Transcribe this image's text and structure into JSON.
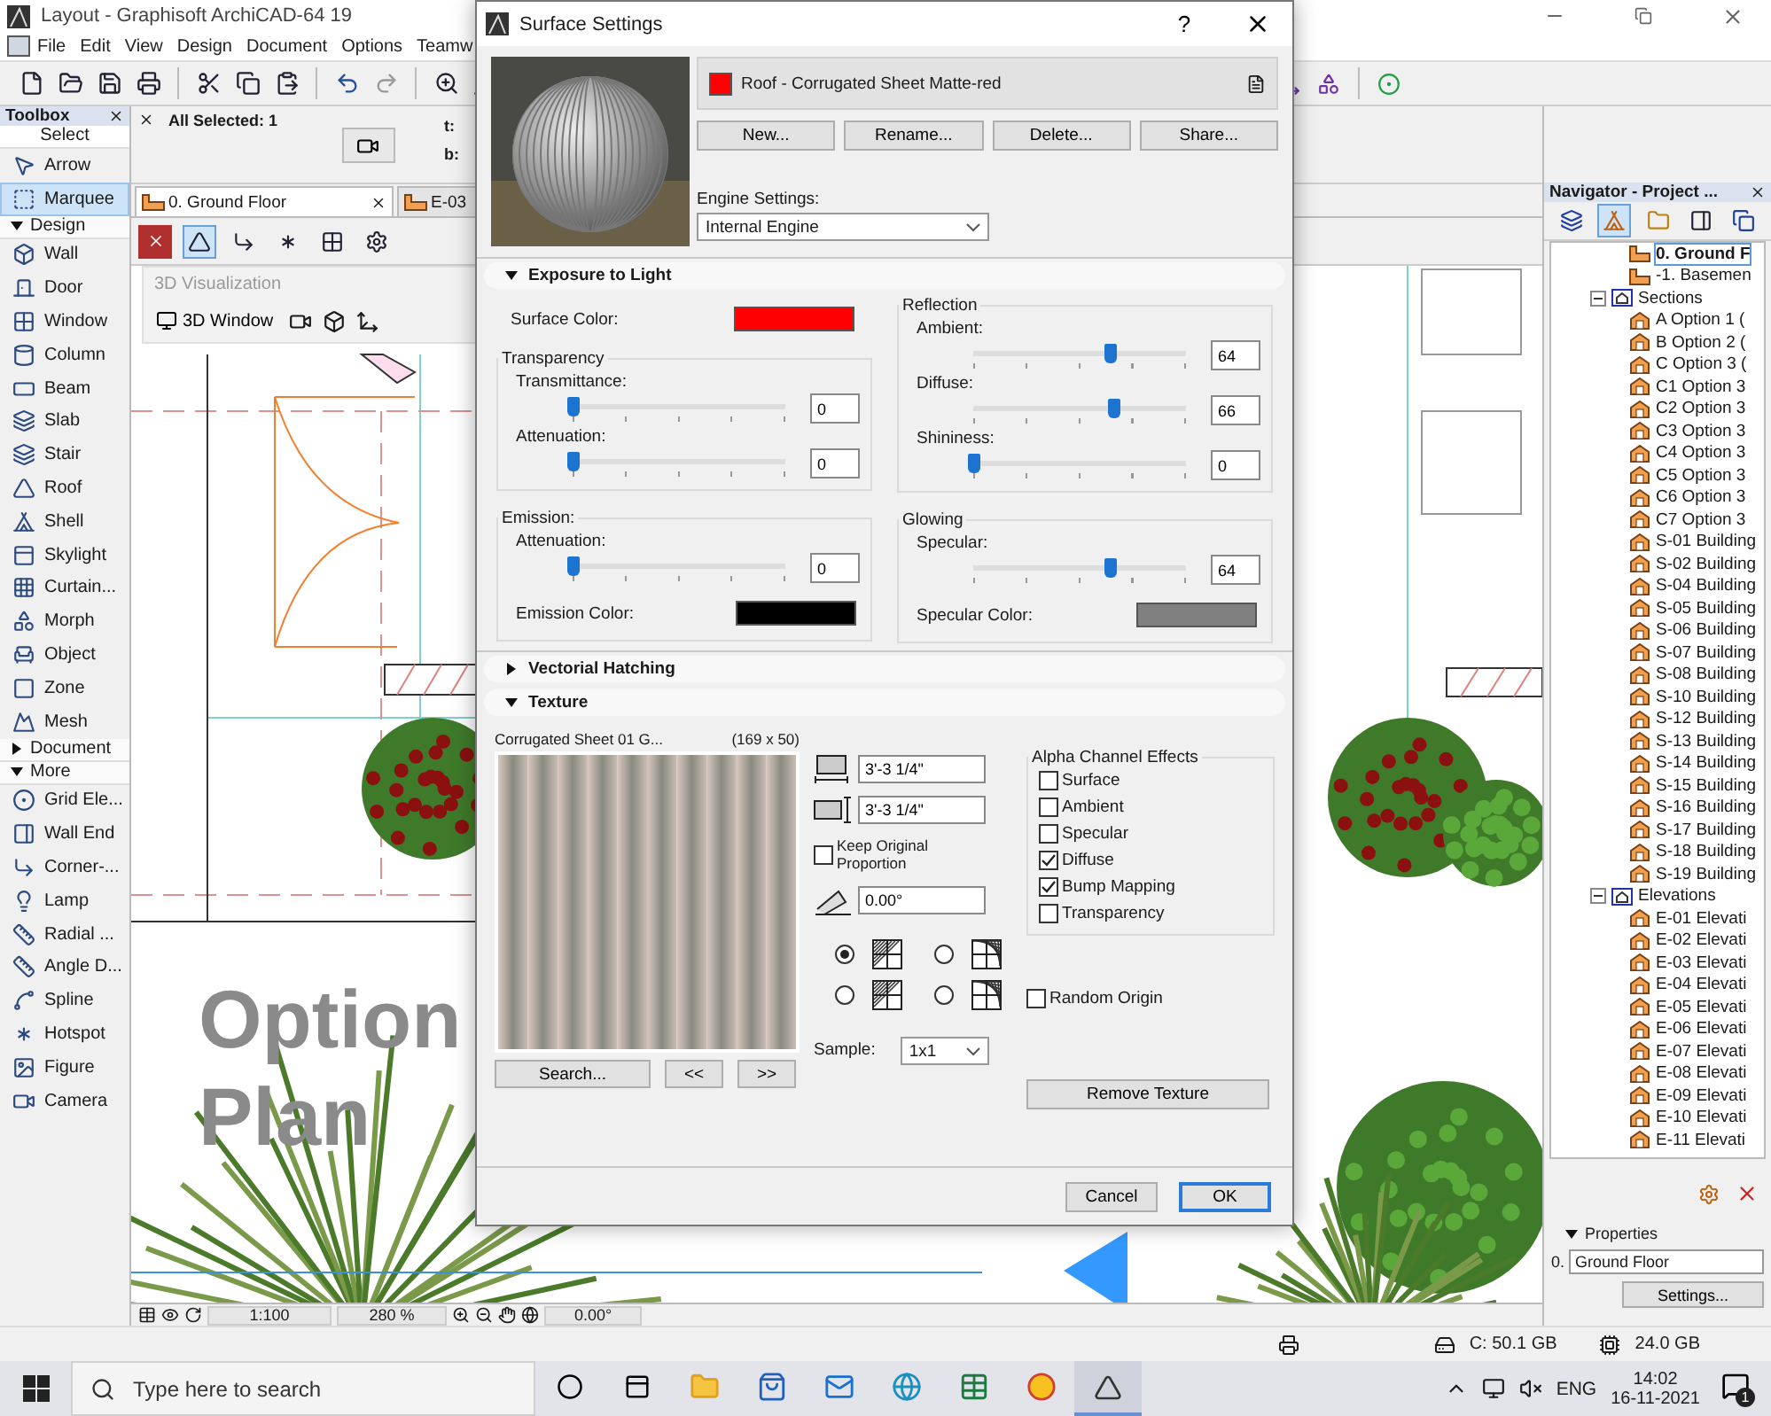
{
  "app": {
    "title": "Layout - Graphisoft ArchiCAD-64 19",
    "menu": [
      "File",
      "Edit",
      "View",
      "Design",
      "Document",
      "Options",
      "Teamw"
    ]
  },
  "toolbox": {
    "title": "Toolbox",
    "select": {
      "label": "Select",
      "tools": [
        {
          "label": "Arrow",
          "selected": false
        },
        {
          "label": "Marquee",
          "selected": true
        }
      ]
    },
    "sections": [
      {
        "label": "Design",
        "expanded": true,
        "tools": [
          {
            "label": "Wall",
            "selected": false
          },
          {
            "label": "Door",
            "selected": false
          },
          {
            "label": "Window",
            "selected": false
          },
          {
            "label": "Column",
            "selected": false
          },
          {
            "label": "Beam",
            "selected": false
          },
          {
            "label": "Slab",
            "selected": false
          },
          {
            "label": "Stair",
            "selected": false
          },
          {
            "label": "Roof",
            "selected": false
          },
          {
            "label": "Shell",
            "selected": false
          },
          {
            "label": "Skylight",
            "selected": false
          },
          {
            "label": "Curtain...",
            "selected": false
          },
          {
            "label": "Morph",
            "selected": false
          },
          {
            "label": "Object",
            "selected": false
          },
          {
            "label": "Zone",
            "selected": false
          },
          {
            "label": "Mesh",
            "selected": false
          }
        ]
      },
      {
        "label": "Document",
        "expanded": false
      },
      {
        "label": "More",
        "expanded": true,
        "tools": [
          {
            "label": "Grid Ele...",
            "selected": false
          },
          {
            "label": "Wall End",
            "selected": false
          },
          {
            "label": "Corner-...",
            "selected": false
          },
          {
            "label": "Lamp",
            "selected": false
          },
          {
            "label": "Radial ...",
            "selected": false
          },
          {
            "label": "Angle D...",
            "selected": false
          },
          {
            "label": "Spline",
            "selected": false
          },
          {
            "label": "Hotspot",
            "selected": false
          },
          {
            "label": "Figure",
            "selected": false
          },
          {
            "label": "Camera",
            "selected": false
          }
        ]
      }
    ]
  },
  "info_box": {
    "label": "All Selected: 1",
    "line_1": "t:",
    "line_2": "b:"
  },
  "tabs": [
    {
      "label": "0. Ground Floor",
      "selected": true
    },
    {
      "label": "E-03",
      "selected": false
    }
  ],
  "palette": {
    "title": "3D Visualization",
    "button": "3D Window"
  },
  "canvas": {
    "labels": [
      "Option",
      "Plan"
    ]
  },
  "zoom_bar": {
    "scale": "1:100",
    "zoom": "280 %",
    "angle": "0.00°"
  },
  "navigator": {
    "title": "Navigator - Project ...",
    "tree": [
      {
        "label": "0. Ground F",
        "selected": true
      },
      {
        "label": "-1. Basemen",
        "selected": false
      },
      {
        "label": "Sections",
        "selected": false,
        "expanded": true,
        "children": [
          {
            "label": "A Option 1 (",
            "selected": false
          },
          {
            "label": "B Option 2 (",
            "selected": false
          },
          {
            "label": "C Option 3 (",
            "selected": false
          },
          {
            "label": "C1 Option 3",
            "selected": false
          },
          {
            "label": "C2 Option 3",
            "selected": false
          },
          {
            "label": "C3 Option 3",
            "selected": false
          },
          {
            "label": "C4 Option 3",
            "selected": false
          },
          {
            "label": "C5 Option 3",
            "selected": false
          },
          {
            "label": "C6 Option 3",
            "selected": false
          },
          {
            "label": "C7 Option 3",
            "selected": false
          },
          {
            "label": "S-01 Building",
            "selected": false
          },
          {
            "label": "S-02 Building",
            "selected": false
          },
          {
            "label": "S-04 Building",
            "selected": false
          },
          {
            "label": "S-05 Building",
            "selected": false
          },
          {
            "label": "S-06 Building",
            "selected": false
          },
          {
            "label": "S-07 Building",
            "selected": false
          },
          {
            "label": "S-08 Building",
            "selected": false
          },
          {
            "label": "S-10 Building",
            "selected": false
          },
          {
            "label": "S-12 Building",
            "selected": false
          },
          {
            "label": "S-13 Building",
            "selected": false
          },
          {
            "label": "S-14 Building",
            "selected": false
          },
          {
            "label": "S-15 Building",
            "selected": false
          },
          {
            "label": "S-16 Building",
            "selected": false
          },
          {
            "label": "S-17 Building",
            "selected": false
          },
          {
            "label": "S-18 Building",
            "selected": false
          },
          {
            "label": "S-19 Building",
            "selected": false
          }
        ]
      },
      {
        "label": "Elevations",
        "selected": false,
        "expanded": true,
        "children": [
          {
            "label": "E-01 Elevati",
            "selected": false
          },
          {
            "label": "E-02 Elevati",
            "selected": false
          },
          {
            "label": "E-03 Elevati",
            "selected": false
          },
          {
            "label": "E-04 Elevati",
            "selected": false
          },
          {
            "label": "E-05 Elevati",
            "selected": false
          },
          {
            "label": "E-06 Elevati",
            "selected": false
          },
          {
            "label": "E-07 Elevati",
            "selected": false
          },
          {
            "label": "E-08 Elevati",
            "selected": false
          },
          {
            "label": "E-09 Elevati",
            "selected": false
          },
          {
            "label": "E-10 Elevati",
            "selected": false
          },
          {
            "label": "E-11 Elevati",
            "selected": false
          }
        ]
      }
    ]
  },
  "properties": {
    "title": "Properties",
    "expanded": true,
    "story": "0.",
    "value": "Ground Floor",
    "button": "Settings..."
  },
  "status_bar": {
    "disk": "C: 50.1 GB",
    "memory": "24.0 GB"
  },
  "taskbar": {
    "search_placeholder": "Type here to search",
    "language": "ENG",
    "time": "14:02",
    "date": "16-11-2021",
    "notifications": "1"
  },
  "dialog": {
    "title": "Surface Settings",
    "help": "?",
    "surface": {
      "name": "Roof - Corrugated Sheet Matte-red",
      "color": "#ff0000"
    },
    "buttons": [
      "New...",
      "Rename...",
      "Delete...",
      "Share..."
    ],
    "engine": {
      "label": "Engine Settings:",
      "value": "Internal Engine"
    },
    "exposure": {
      "title": "Exposure to Light",
      "expanded": true,
      "surface_color": {
        "label": "Surface Color:",
        "color": "#ff0000"
      },
      "transparency": {
        "title": "Transparency",
        "sliders": [
          {
            "label": "Transmittance:",
            "level": 0,
            "value": "0"
          },
          {
            "label": "Attenuation:",
            "level": 0,
            "value": "0"
          }
        ]
      },
      "emission": {
        "title": "Emission:",
        "sliders": [
          {
            "label": "Attenuation:",
            "level": 0,
            "value": "0"
          }
        ],
        "color_row": {
          "label": "Emission Color:",
          "color": "#000000"
        }
      },
      "reflection": {
        "title": "Reflection",
        "sliders": [
          {
            "label": "Ambient:",
            "level": 0.64,
            "value": "64"
          },
          {
            "label": "Diffuse:",
            "level": 0.66,
            "value": "66"
          },
          {
            "label": "Shininess:",
            "level": 0,
            "value": "0"
          }
        ]
      },
      "glowing": {
        "title": "Glowing",
        "sliders": [
          {
            "label": "Specular:",
            "level": 0.64,
            "value": "64"
          }
        ],
        "color_row": {
          "label": "Specular Color:",
          "color": "#808080"
        }
      }
    },
    "hatching": {
      "title": "Vectorial Hatching",
      "expanded": false
    },
    "texture": {
      "title": "Texture",
      "expanded": true,
      "name": "Corrugated Sheet 01 G...",
      "size": "(169 x 50)",
      "width": "3'-3 1/4\"",
      "height": "3'-3 1/4\"",
      "keep_proportion": {
        "label": "Keep Original Proportion",
        "checked": false
      },
      "angle": "0.00°",
      "mapping": [
        {
          "selected": true
        },
        {
          "selected": false
        },
        {
          "selected": false
        },
        {
          "selected": false
        }
      ],
      "search": "Search...",
      "prev": "<<",
      "next": ">>",
      "sample": {
        "label": "Sample:",
        "value": "1x1"
      },
      "alpha": {
        "title": "Alpha Channel Effects",
        "options": [
          {
            "label": "Surface",
            "checked": false
          },
          {
            "label": "Ambient",
            "checked": false
          },
          {
            "label": "Specular",
            "checked": false
          },
          {
            "label": "Diffuse",
            "checked": true
          },
          {
            "label": "Bump Mapping",
            "checked": true
          },
          {
            "label": "Transparency",
            "checked": false
          }
        ]
      },
      "random_origin": {
        "label": "Random Origin",
        "checked": false
      },
      "remove": "Remove Texture"
    },
    "actions": [
      {
        "label": "Cancel",
        "default": false
      },
      {
        "label": "OK",
        "default": true
      }
    ]
  }
}
